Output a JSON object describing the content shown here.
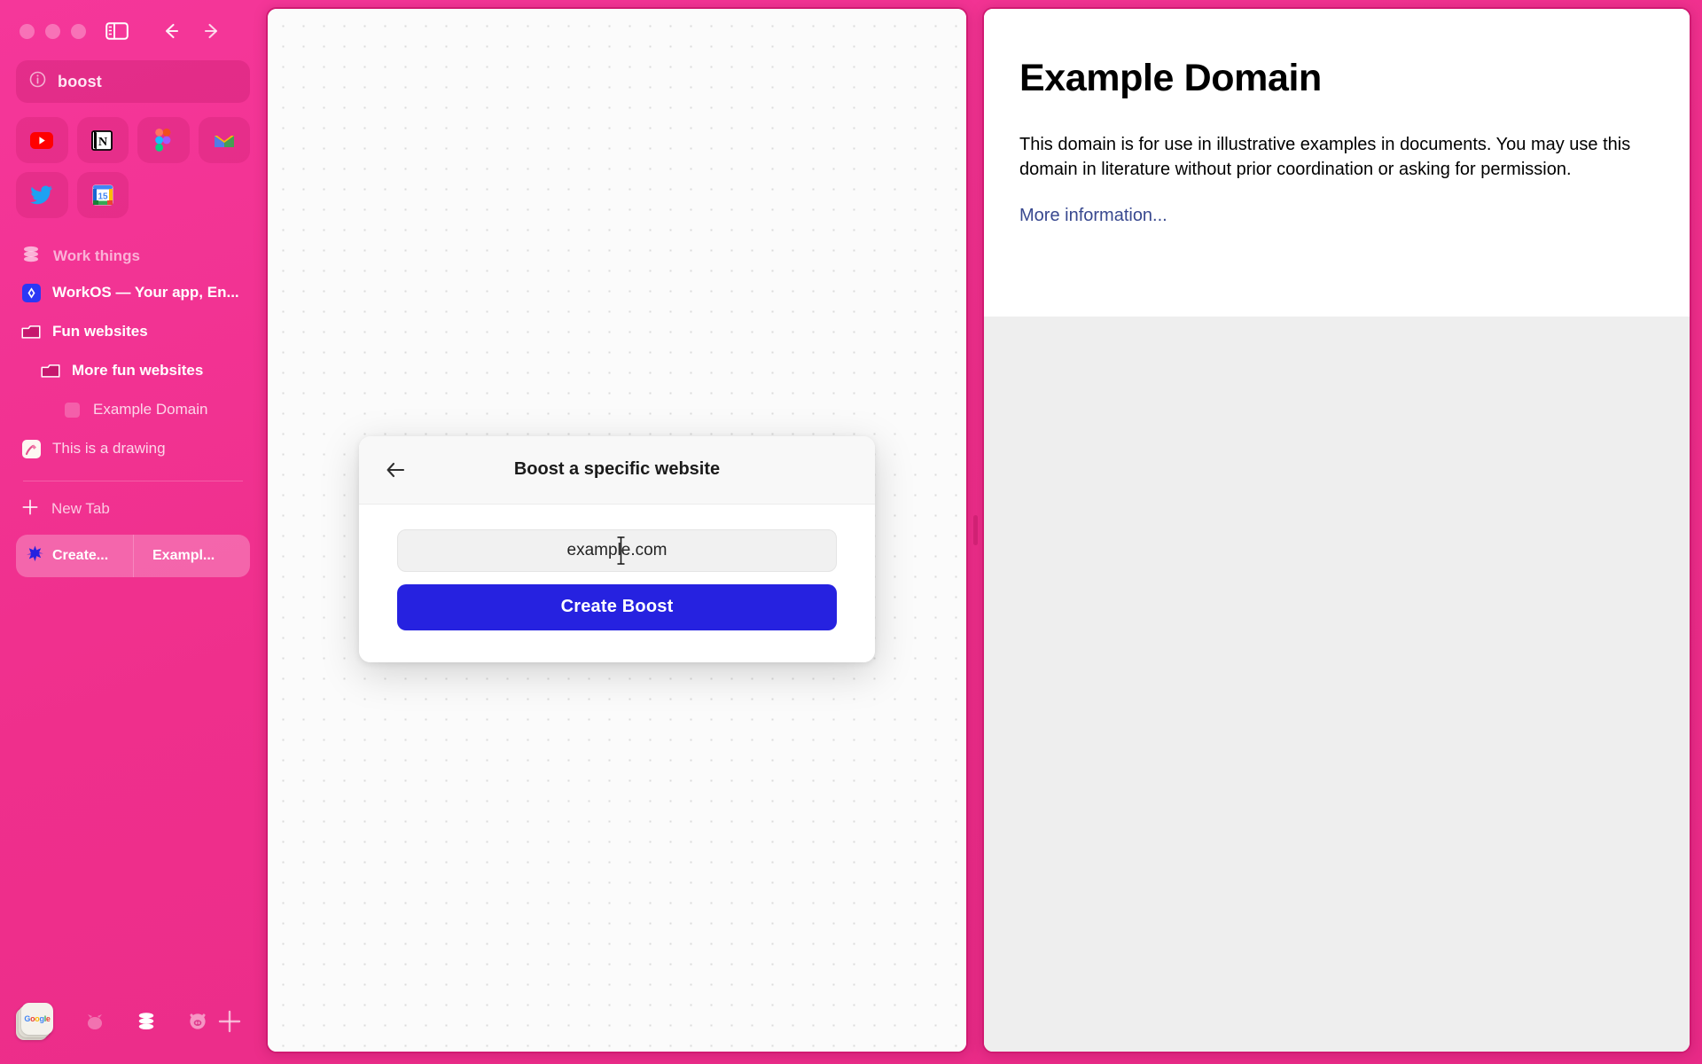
{
  "browser": {
    "window_controls": [
      "close",
      "minimize",
      "maximize"
    ],
    "sidebar_toggle_icon": "sidebar-toggle-icon",
    "back_icon": "arrow-left-icon",
    "forward_icon": "arrow-right-icon",
    "reload_icon": "reload-icon"
  },
  "urlbar": {
    "icon": "info-circle-icon",
    "value": "boost"
  },
  "pins": [
    {
      "name": "youtube",
      "label": "YouTube"
    },
    {
      "name": "notion",
      "label": "Notion"
    },
    {
      "name": "figma",
      "label": "Figma"
    },
    {
      "name": "gmail",
      "label": "Gmail"
    },
    {
      "name": "twitter",
      "label": "Twitter"
    },
    {
      "name": "google-calendar",
      "label": "Google Calendar"
    }
  ],
  "sidebar": {
    "space_name": "Work things",
    "space_icon": "database-stack-icon",
    "items": [
      {
        "label": "WorkOS — Your app, En...",
        "icon": "workos-icon",
        "indent": 0,
        "type": "tab"
      },
      {
        "label": "Fun websites",
        "icon": "folder-icon",
        "indent": 0,
        "type": "folder"
      },
      {
        "label": "More fun websites",
        "icon": "folder-icon",
        "indent": 1,
        "type": "folder"
      },
      {
        "label": "Example Domain",
        "icon": "blank-favicon",
        "indent": 2,
        "type": "tab"
      },
      {
        "label": "This is a drawing",
        "icon": "drawing-icon",
        "indent": 0,
        "type": "tab"
      }
    ],
    "new_tab": {
      "label": "New Tab",
      "icon": "plus-icon"
    },
    "split_group": [
      {
        "label": "Create...",
        "icon": "sparkle-icon"
      },
      {
        "label": "Exampl...",
        "icon": "blank-favicon"
      }
    ]
  },
  "bottombar": {
    "profile_label": "Google",
    "spaces": [
      {
        "name": "space-faded-icon"
      },
      {
        "name": "database-stack-icon"
      },
      {
        "name": "pig-face-icon"
      }
    ],
    "add_space_icon": "plus-icon"
  },
  "modal": {
    "back_icon": "arrow-left-icon",
    "title": "Boost a specific website",
    "input_value": "example.com",
    "input_placeholder": "example.com",
    "submit_label": "Create Boost",
    "accent_color": "#2622e0"
  },
  "page": {
    "heading": "Example Domain",
    "paragraph": "This domain is for use in illustrative examples in documents. You may use this domain in literature without prior coordination or asking for permission.",
    "link": "More information...",
    "link_color": "#38488f"
  },
  "theme": {
    "sidebar_pink": "#f2368f",
    "panel_border": "#d11a72"
  }
}
